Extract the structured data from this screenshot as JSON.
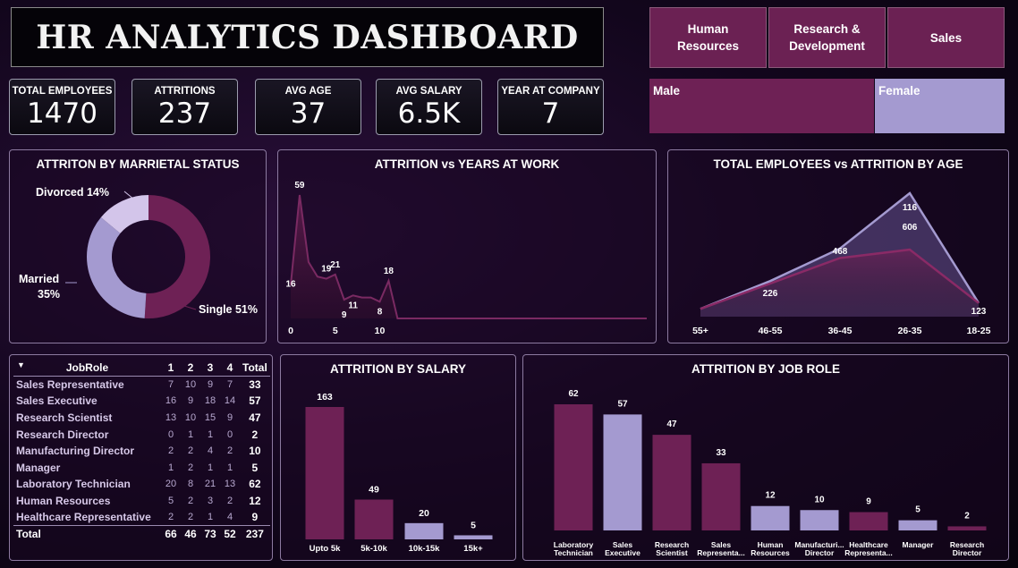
{
  "header": {
    "title": "HR ANALYTICS DASHBOARD"
  },
  "departments": [
    "Human\nResources",
    "Research &\nDevelopment",
    "Sales"
  ],
  "kpis": [
    {
      "label": "TOTAL EMPLOYEES",
      "value": "1470"
    },
    {
      "label": "ATTRITIONS",
      "value": "237"
    },
    {
      "label": "AVG AGE",
      "value": "37"
    },
    {
      "label": "AVG SALARY",
      "value": "6.5K"
    },
    {
      "label": "YEAR AT COMPANY",
      "value": "7"
    }
  ],
  "gender": {
    "male": "Male",
    "female": "Female"
  },
  "colors": {
    "plum": "#6e2155",
    "lavender": "#a49ad0",
    "lightLavender": "#d3c5ea"
  },
  "marital": {
    "title": "ATTRITON BY MARRIETAL STATUS",
    "labels": {
      "divorced": "Divorced 14%",
      "married_1": "Married",
      "married_2": "35%",
      "single": "Single 51%"
    }
  },
  "years": {
    "title": "ATTRITION vs YEARS AT WORK"
  },
  "age": {
    "title": "TOTAL EMPLOYEES vs ATTRITION BY AGE"
  },
  "salary": {
    "title": "ATTRITION BY SALARY"
  },
  "jobrole": {
    "title": "ATTRITION BY JOB ROLE"
  },
  "table": {
    "headers": [
      "JobRole",
      "1",
      "2",
      "3",
      "4",
      "Total"
    ],
    "rows": [
      [
        "Sales Representative",
        "7",
        "10",
        "9",
        "7",
        "33"
      ],
      [
        "Sales Executive",
        "16",
        "9",
        "18",
        "14",
        "57"
      ],
      [
        "Research Scientist",
        "13",
        "10",
        "15",
        "9",
        "47"
      ],
      [
        "Research Director",
        "0",
        "1",
        "1",
        "0",
        "2"
      ],
      [
        "Manufacturing Director",
        "2",
        "2",
        "4",
        "2",
        "10"
      ],
      [
        "Manager",
        "1",
        "2",
        "1",
        "1",
        "5"
      ],
      [
        "Laboratory Technician",
        "20",
        "8",
        "21",
        "13",
        "62"
      ],
      [
        "Human Resources",
        "5",
        "2",
        "3",
        "2",
        "12"
      ],
      [
        "Healthcare Representative",
        "2",
        "2",
        "1",
        "4",
        "9"
      ]
    ],
    "total": [
      "Total",
      "66",
      "46",
      "73",
      "52",
      "237"
    ]
  },
  "chart_data": [
    {
      "type": "pie",
      "title": "ATTRITON BY MARRIETAL STATUS",
      "categories": [
        "Single",
        "Married",
        "Divorced"
      ],
      "values": [
        51,
        35,
        14
      ]
    },
    {
      "type": "area",
      "title": "ATTRITION vs YEARS AT WORK",
      "x": [
        0,
        1,
        2,
        3,
        4,
        5,
        6,
        7,
        8,
        9,
        10,
        11,
        12,
        13,
        14,
        15,
        16,
        17,
        18,
        19,
        20,
        21,
        22,
        23,
        24,
        25,
        26,
        27,
        28,
        29,
        30,
        31,
        32,
        33,
        34,
        35,
        36,
        37,
        38,
        39,
        40
      ],
      "values": [
        16,
        59,
        27,
        20,
        19,
        21,
        9,
        11,
        10,
        10,
        8,
        18,
        0,
        0,
        0,
        0,
        0,
        0,
        0,
        0,
        0,
        0,
        0,
        0,
        0,
        0,
        0,
        0,
        0,
        0,
        0,
        0,
        0,
        0,
        0,
        0,
        0,
        0,
        0,
        0,
        0
      ],
      "point_labels": {
        "0": "16",
        "1": "59",
        "4": "19",
        "5": "21",
        "6": "9",
        "7": "11",
        "10": "8",
        "11": "18"
      },
      "xticks": [
        "0",
        "5",
        "10"
      ],
      "ylim": [
        0,
        65
      ]
    },
    {
      "type": "area",
      "title": "TOTAL EMPLOYEES vs ATTRITION BY AGE",
      "categories": [
        "55+",
        "46-55",
        "36-45",
        "26-35",
        "18-25"
      ],
      "series": [
        {
          "values": [
            70,
            322,
            616,
            1116,
            123
          ]
        },
        {
          "values": [
            70,
            300,
            530,
            606,
            123
          ]
        }
      ],
      "point_labels": [
        "226",
        "468",
        "116",
        "606",
        "123"
      ]
    },
    {
      "type": "bar",
      "title": "ATTRITION BY SALARY",
      "categories": [
        "Upto 5k",
        "5k-10k",
        "10k-15k",
        "15k+"
      ],
      "values": [
        163,
        49,
        20,
        5
      ]
    },
    {
      "type": "bar",
      "title": "ATTRITION BY JOB ROLE",
      "categories": [
        [
          "Laboratory",
          "Technician"
        ],
        [
          "Sales",
          "Executive"
        ],
        [
          "Research",
          "Scientist"
        ],
        [
          "Sales",
          "Representa..."
        ],
        [
          "Human",
          "Resources"
        ],
        [
          "Manufacturi...",
          "Director"
        ],
        [
          "Healthcare",
          "Representa..."
        ],
        [
          "Manager",
          ""
        ],
        [
          "Research",
          "Director"
        ]
      ],
      "values": [
        62,
        57,
        47,
        33,
        12,
        10,
        9,
        5,
        2
      ]
    }
  ]
}
